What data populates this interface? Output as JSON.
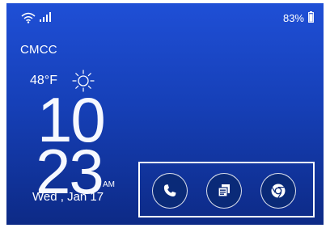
{
  "status_bar": {
    "battery_percent": "83%"
  },
  "lockscreen": {
    "carrier": "CMCC",
    "weather": {
      "temperature": "48°F",
      "icon": "sun-icon"
    },
    "clock": {
      "hour": "10",
      "minute": "23",
      "ampm": "AM"
    },
    "date": "Wed , Jan 17"
  },
  "shortcuts": [
    {
      "icon": "phone-icon"
    },
    {
      "icon": "messages-icon"
    },
    {
      "icon": "chrome-icon"
    }
  ]
}
